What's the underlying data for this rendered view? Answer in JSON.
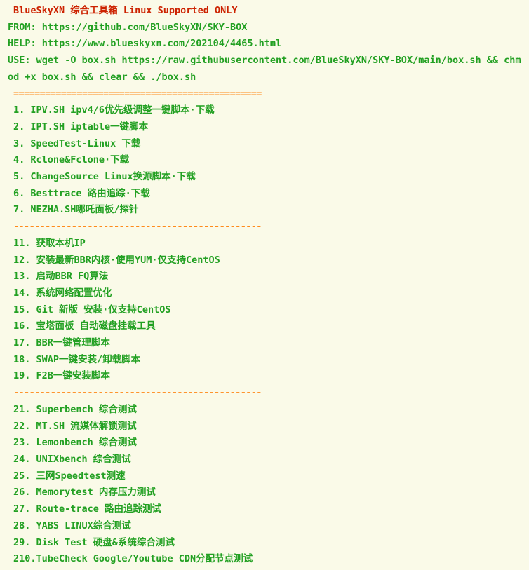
{
  "header": {
    "title": "BlueSkyXN 综合工具箱 Linux Supported ONLY",
    "from": "FROM: https://github.com/BlueSkyXN/SKY-BOX",
    "help": "HELP: https://www.blueskyxn.com/202104/4465.html",
    "use": "USE:  wget -O box.sh https://raw.githubusercontent.com/BlueSkyXN/SKY-BOX/main/box.sh && chmod +x box.sh && clear && ./box.sh"
  },
  "separators": {
    "double": "===============================================",
    "dash": "-----------------------------------------------"
  },
  "group1": [
    "1. IPV.SH ipv4/6优先级调整一键脚本·下载",
    "2. IPT.SH iptable一键脚本",
    "3. SpeedTest-Linux 下载",
    "4. Rclone&Fclone·下载",
    "5. ChangeSource Linux换源脚本·下载",
    "6. Besttrace 路由追踪·下载",
    "7. NEZHA.SH哪吒面板/探针"
  ],
  "group2": [
    "11. 获取本机IP",
    "12. 安装最新BBR内核·使用YUM·仅支持CentOS",
    "13. 启动BBR FQ算法",
    "14. 系统网络配置优化",
    "15. Git 新版 安装·仅支持CentOS",
    "16. 宝塔面板 自动磁盘挂载工具",
    "17. BBR一键管理脚本",
    "18. SWAP一键安装/卸载脚本",
    "19. F2B一键安装脚本"
  ],
  "group3": [
    "21. Superbench 综合测试",
    "22. MT.SH 流媒体解锁测试",
    "23. Lemonbench 综合测试",
    "24. UNIXbench 综合测试",
    "25. 三网Speedtest测速",
    "26. Memorytest 内存压力测试",
    "27. Route-trace 路由追踪测试",
    "28. YABS LINUX综合测试",
    "29. Disk Test 硬盘&系统综合测试",
    "210.TubeCheck Google/Youtube CDN分配节点测试"
  ],
  "colors": {
    "background": "#fafae8",
    "title": "#cc2200",
    "text": "#22a022",
    "separator": "#ff8a1a"
  }
}
